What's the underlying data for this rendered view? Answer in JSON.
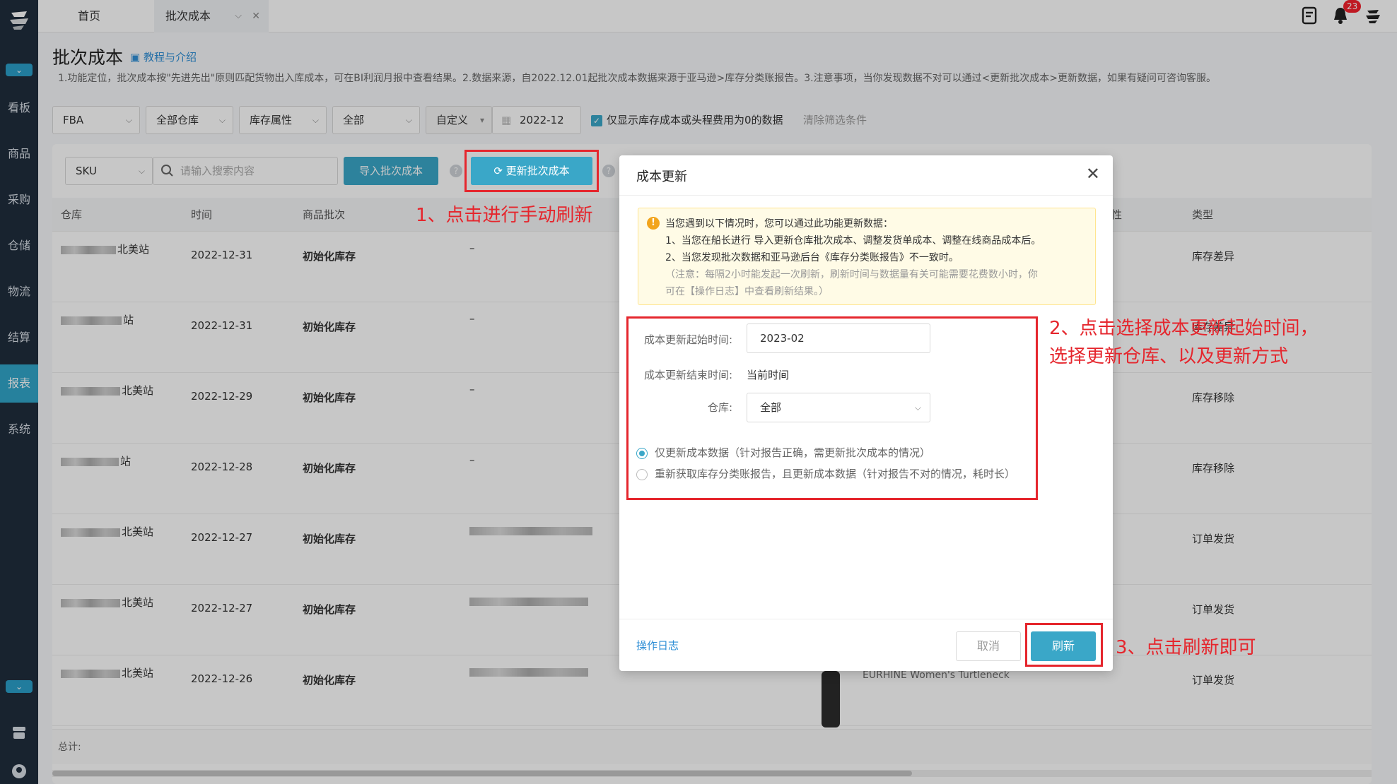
{
  "sidebar": {
    "items": [
      {
        "label": "看板"
      },
      {
        "label": "商品"
      },
      {
        "label": "采购"
      },
      {
        "label": "仓储"
      },
      {
        "label": "物流"
      },
      {
        "label": "结算"
      },
      {
        "label": "报表",
        "active": true
      },
      {
        "label": "系统"
      }
    ]
  },
  "tabs": {
    "home": "首页",
    "current": "批次成本"
  },
  "header": {
    "notification_count": "23"
  },
  "page": {
    "title": "批次成本",
    "tutorial_link": "教程与介绍",
    "description": "1.功能定位，批次成本按\"先进先出\"原则匹配货物出入库成本，可在BI利润月报中查看结果。2.数据来源，自2022.12.01起批次成本数据来源于亚马逊>库存分类账报告。3.注意事项，当你发现数据不对可以通过<更新批次成本>更新数据，如果有疑问可咨询客服。"
  },
  "filters": {
    "channel": "FBA",
    "warehouse": "全部仓库",
    "stock_attr": "库存属性",
    "all": "全部",
    "date_mode": "自定义",
    "month": "2022-12",
    "checkbox_label": "仅显示库存成本或头程费用为0的数据",
    "clear": "清除筛选条件"
  },
  "toolbar": {
    "search_field": "SKU",
    "search_placeholder": "请输入搜索内容",
    "import_button": "导入批次成本",
    "update_button": "更新批次成本"
  },
  "table": {
    "headers": {
      "warehouse": "仓库",
      "time": "时间",
      "batch": "商品批次",
      "attr": "性",
      "type": "类型"
    },
    "rows": [
      {
        "warehouse_suffix": "北美站",
        "time": "2022-12-31",
        "batch": "初始化库存",
        "col4": "–",
        "type": "库存差异"
      },
      {
        "warehouse_suffix": "站",
        "time": "2022-12-31",
        "batch": "初始化库存",
        "col4": "–",
        "type": "库存差异"
      },
      {
        "warehouse_suffix": "北美站",
        "time": "2022-12-29",
        "batch": "初始化库存",
        "col4": "–",
        "type": "库存移除"
      },
      {
        "warehouse_suffix": "站",
        "time": "2022-12-28",
        "batch": "初始化库存",
        "col4": "–",
        "type": "库存移除"
      },
      {
        "warehouse_suffix": "北美站",
        "time": "2022-12-27",
        "batch": "初始化库存",
        "col4": "",
        "type": "订单发货"
      },
      {
        "warehouse_suffix": "北美站",
        "time": "2022-12-27",
        "batch": "初始化库存",
        "col4": "",
        "type": "订单发货"
      },
      {
        "warehouse_suffix": "北美站",
        "time": "2022-12-26",
        "batch": "初始化库存",
        "col4": "",
        "type": "订单发货"
      }
    ],
    "total_label": "总计:",
    "product_title": "EURHINE Women's Turtleneck"
  },
  "annotations": {
    "step1": "1、点击进行手动刷新",
    "step2_line1": "2、点击选择成本更新起始时间，",
    "step2_line2": "选择更新仓库、以及更新方式",
    "step3": "3、点击刷新即可"
  },
  "modal": {
    "title": "成本更新",
    "warning": {
      "intro": "当您遇到以下情况时，您可以通过此功能更新数据：",
      "line1": "1、当您在船长进行 导入更新仓库批次成本、调整发货单成本、调整在线商品成本后。",
      "line2": "2、当您发现批次数据和亚马逊后台《库存分类账报告》不一致时。",
      "note1": "（注意：每隔2小时能发起一次刷新，刷新时间与数据量有关可能需要花费数小时，你",
      "note2": "可在【操作日志】中查看刷新结果。）"
    },
    "start_label": "成本更新起始时间:",
    "start_value": "2023-02",
    "end_label": "成本更新结束时间:",
    "end_value": "当前时间",
    "warehouse_label": "仓库:",
    "warehouse_value": "全部",
    "option1": "仅更新成本数据（针对报告正确，需更新批次成本的情况）",
    "option2": "重新获取库存分类账报告，且更新成本数据（针对报告不对的情况，耗时长）",
    "op_log": "操作日志",
    "cancel": "取消",
    "refresh": "刷新"
  },
  "colors": {
    "sidebar": "#1f2d3d",
    "accent": "#3aa7c8",
    "annotation": "#e5262d"
  }
}
